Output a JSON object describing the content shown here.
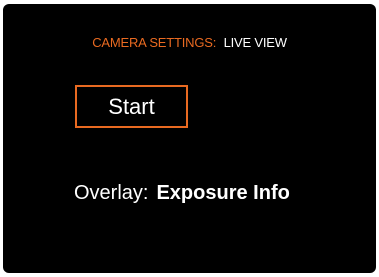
{
  "header": {
    "label": "CAMERA SETTINGS:",
    "mode": "LIVE VIEW"
  },
  "start_button": {
    "label": "Start"
  },
  "overlay": {
    "label": "Overlay:",
    "value": "Exposure Info"
  },
  "colors": {
    "accent": "#e96a21",
    "background": "#000000",
    "text": "#ffffff"
  }
}
